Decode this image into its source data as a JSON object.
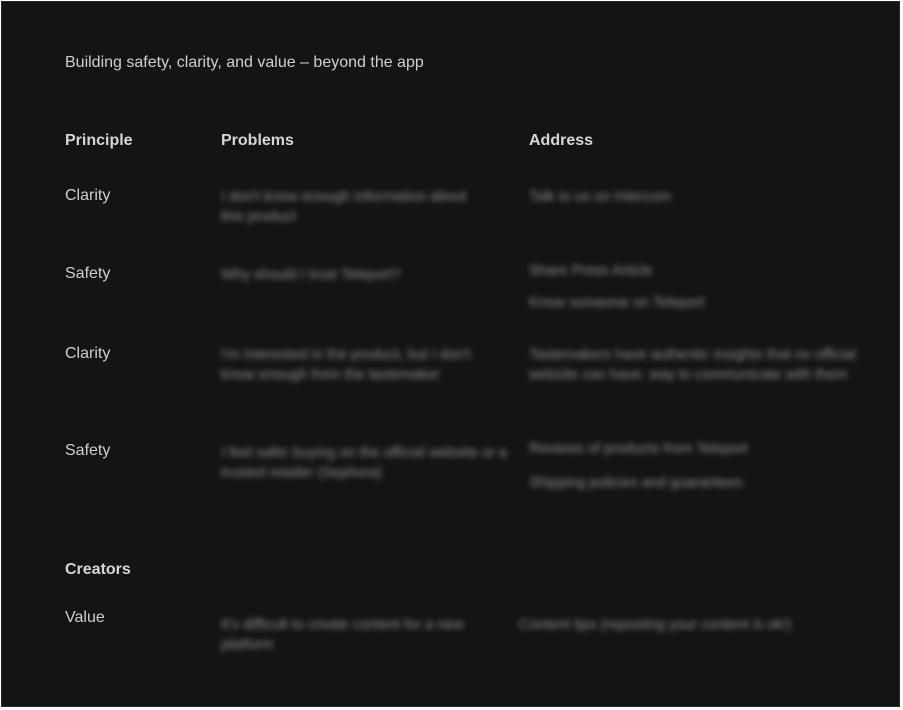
{
  "intro": "Building safety, clarity, and value – beyond the app",
  "headers": {
    "principle": "Principle",
    "problems": "Problems",
    "address": "Address"
  },
  "rows": [
    {
      "principle": "Clarity",
      "problem": "I don't know enough information about this product",
      "address": [
        "Talk to us on Intercom"
      ]
    },
    {
      "principle": "Safety",
      "problem": "Why should I trust Teleport?",
      "address": [
        "Share Press Article",
        "Know someone on Teleport"
      ]
    },
    {
      "principle": "Clarity",
      "problem": "I'm interested in the product, but I don't know enough from the tastemaker",
      "address": [
        "Tastemakers have authentic insights that no official website can have: way to communicate with them"
      ]
    },
    {
      "principle": "Safety",
      "problem": "I feel safer buying on the official website or a trusted retailer (Sephora)",
      "address": [
        "Reviews of products from Teleport",
        "Shipping policies and guarantees"
      ]
    }
  ],
  "creators": {
    "title": "Creators",
    "rows": [
      {
        "principle": "Value",
        "problem": "It's difficult to create content for a new platform",
        "address": [
          "Content tips (reposting your content is ok!)"
        ]
      }
    ]
  }
}
